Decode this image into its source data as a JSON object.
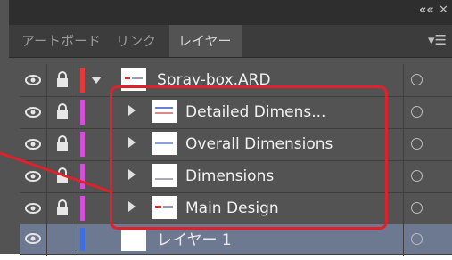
{
  "window": {
    "collapse_label": "««",
    "close_label": "✕",
    "menu_icon": "panel-menu-icon"
  },
  "tabs": [
    {
      "label": "アートボード",
      "active": false
    },
    {
      "label": "リンク",
      "active": false
    },
    {
      "label": "レイヤー",
      "active": true
    }
  ],
  "colors": {
    "accent_highlight": "#e0202a",
    "selection_bg": "#6d7891",
    "layer_red": "#e03a3a",
    "layer_magenta": "#d24fd6",
    "layer_blue": "#3d6fe0"
  },
  "layers": [
    {
      "name": "Spray-box.ARD",
      "level": 0,
      "expanded": true,
      "visible": true,
      "locked": true,
      "color": "#e03a3a",
      "selected": false
    },
    {
      "name": "Detailed Dimens...",
      "level": 1,
      "expanded": false,
      "visible": true,
      "locked": true,
      "color": "#d24fd6",
      "selected": false
    },
    {
      "name": "Overall Dimensions",
      "level": 1,
      "expanded": false,
      "visible": true,
      "locked": true,
      "color": "#d24fd6",
      "selected": false
    },
    {
      "name": "Dimensions",
      "level": 1,
      "expanded": false,
      "visible": true,
      "locked": true,
      "color": "#d24fd6",
      "selected": false
    },
    {
      "name": "Main Design",
      "level": 1,
      "expanded": false,
      "visible": true,
      "locked": true,
      "color": "#d24fd6",
      "selected": false
    },
    {
      "name": "レイヤー 1",
      "level": 0,
      "expanded": false,
      "visible": true,
      "locked": false,
      "color": "#3d6fe0",
      "selected": true
    }
  ]
}
